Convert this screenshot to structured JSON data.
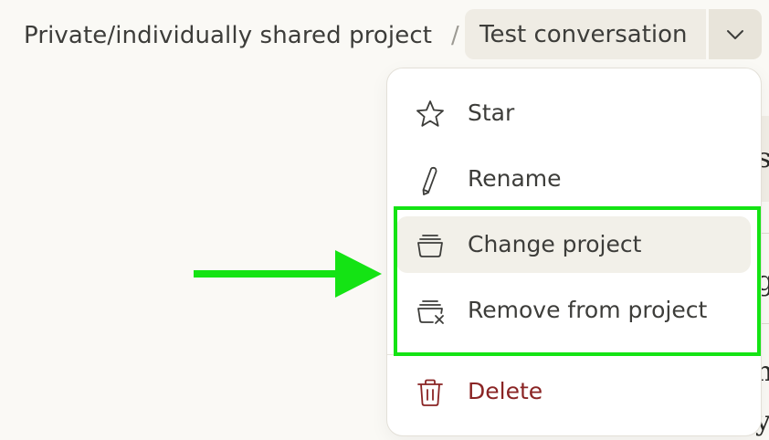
{
  "breadcrumb": {
    "project": "Private/individually shared project",
    "separator": "/",
    "conversation": "Test conversation"
  },
  "menu": {
    "items": [
      {
        "label": "Star",
        "icon": "star-icon"
      },
      {
        "label": "Rename",
        "icon": "pencil-icon"
      },
      {
        "label": "Change project",
        "icon": "folder-stack-icon"
      },
      {
        "label": "Remove from project",
        "icon": "folder-remove-icon"
      },
      {
        "label": "Delete",
        "icon": "trash-icon"
      }
    ]
  },
  "background_fragments": [
    "s",
    "g",
    "n",
    "y"
  ],
  "colors": {
    "highlight": "#14e314",
    "arrow": "#14e314",
    "danger": "#8a2424",
    "hover_bg": "#f2f0e9"
  }
}
